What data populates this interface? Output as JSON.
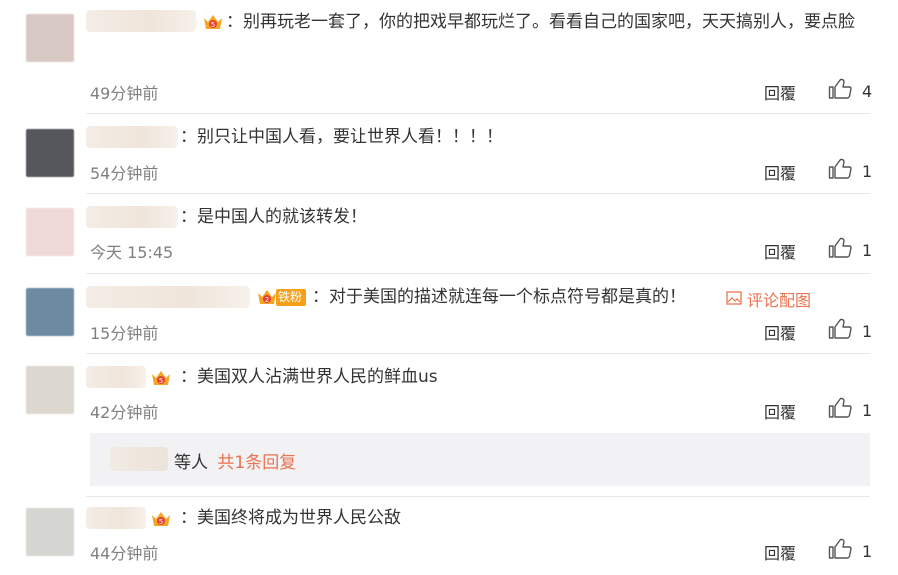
{
  "comments": [
    {
      "text": "：别再玩老一套了，你的把戏早都玩烂了。看看自己的国家吧，天天搞别人，要点脸",
      "time": "49分钟前",
      "reply": "回覆",
      "likes": "4",
      "avatar_color": "#d8c8c4",
      "badge": "crown"
    },
    {
      "text": "：别只让中国人看，要让世界人看！！！！",
      "time": "54分钟前",
      "reply": "回覆",
      "likes": "1",
      "avatar_color": "#5a5a60",
      "badge": "none"
    },
    {
      "text": "：是中国人的就该转发！",
      "time": "今天 15:45",
      "reply": "回覆",
      "likes": "1",
      "avatar_color": "#ead2d2",
      "badge": "none"
    },
    {
      "text": "：对于美国的描述就连每一个标点符号都是真的！",
      "time": "15分钟前",
      "reply": "回覆",
      "likes": "1",
      "avatar_color": "#6b8aa3",
      "badge": "fan",
      "fan_label": "铁粉",
      "fan_level": "2",
      "img_link": "评论配图"
    },
    {
      "text": "：美国双人沾满世界人民的鲜血us",
      "time": "42分钟前",
      "reply": "回覆",
      "likes": "1",
      "avatar_color": "#ddd8d0",
      "badge": "crown5"
    },
    {
      "text": "：美国终将成为世界人民公敌",
      "time": "44分钟前",
      "reply": "回覆",
      "likes": "1",
      "avatar_color": "#d4d4d0",
      "badge": "crown5"
    }
  ],
  "sub_reply": {
    "text": "等人",
    "link": "共1条回复"
  },
  "colors": {
    "accent": "#eb7350",
    "muted": "#808080",
    "divider": "#e6e6e6"
  }
}
